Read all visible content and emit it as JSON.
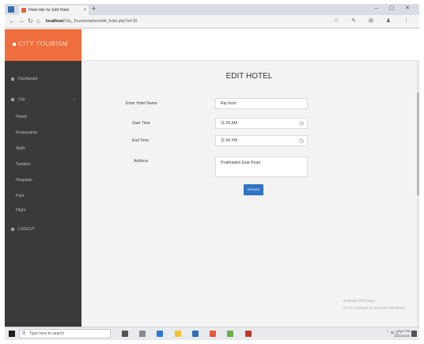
{
  "browser": {
    "tab_title": "Hotel title for Edit Hotel",
    "tab_close": "×",
    "new_tab": "+",
    "window_controls": "– ▢ ✕",
    "nav_back": "←",
    "nav_forward": "→",
    "nav_reload": "↻",
    "nav_home": "⌂",
    "url_host": "localhost",
    "url_path": "/City_Tourism/admin/edit_hotel.php?id=18",
    "toolbar_icons": "☆ ✎ ⊞ ♟ ⋮"
  },
  "app": {
    "brand": "CITY TOURISM"
  },
  "sidebar": {
    "dashboard": "Dashboard",
    "city": "City",
    "city_caret": "‹",
    "subitems": [
      "Hotels",
      "Restaurants",
      "Malls",
      "Temples",
      "Hospitals",
      "Park",
      "Flight"
    ],
    "logout": "LOGOUT"
  },
  "page": {
    "title": "EDIT HOTEL",
    "fields": {
      "hotel_name_label": "Enter Hotel Name",
      "hotel_name_value": "Raj hotel",
      "start_time_label": "Start Time",
      "start_time_value": "11:00 AM",
      "end_time_label": "End Time",
      "end_time_value": "11:00 PM",
      "address_label": "Address",
      "address_value": "Prabhadevi East Road"
    },
    "update_button": "UPDATE",
    "clock_icon": "clock-icon"
  },
  "watermark": {
    "line1": "Activate Windows",
    "line2": "Go to Settings to activate Windows."
  },
  "taskbar": {
    "search_placeholder": "Type here to search",
    "tray": "⌃ ⊕ ◫ ♪",
    "time": "9:41 PM",
    "date": "12/04/2020"
  },
  "colors": {
    "brand_orange": "#ef6e3d",
    "sidebar_bg": "#3a3a3a",
    "button_blue": "#2f74c0"
  }
}
